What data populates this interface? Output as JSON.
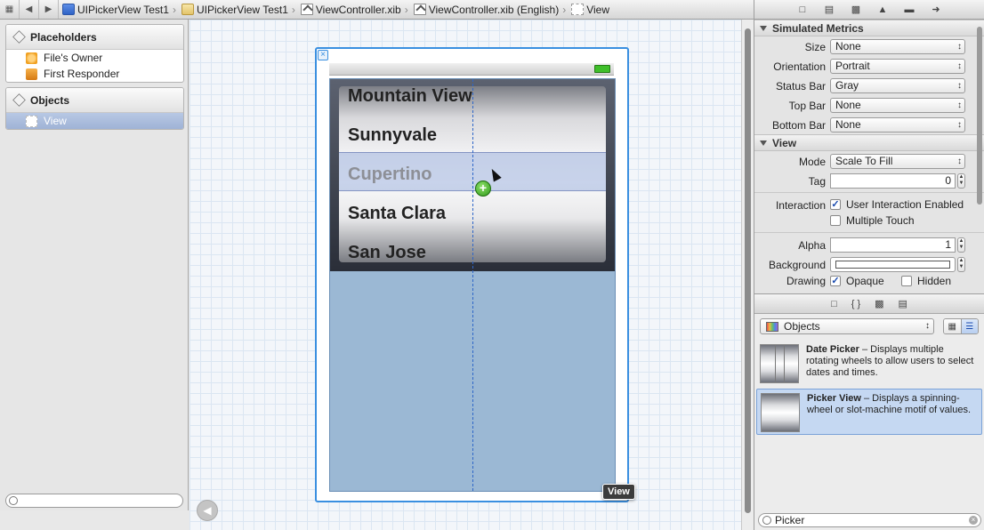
{
  "breadcrumbs": [
    {
      "label": "UIPickerView Test1",
      "icon": "project-icon"
    },
    {
      "label": "UIPickerView Test1",
      "icon": "folder-icon"
    },
    {
      "label": "ViewController.xib",
      "icon": "xib-icon"
    },
    {
      "label": "ViewController.xib (English)",
      "icon": "xib-icon"
    },
    {
      "label": "View",
      "icon": "view-icon"
    }
  ],
  "outline": {
    "placeholders_title": "Placeholders",
    "placeholders": [
      "File's Owner",
      "First Responder"
    ],
    "objects_title": "Objects",
    "objects": [
      "View"
    ]
  },
  "picker": {
    "items": [
      "Mountain View",
      "Sunnyvale",
      "Cupertino",
      "Santa Clara",
      "San Jose"
    ],
    "selected_index": 2
  },
  "canvas": {
    "selection_tooltip": "View"
  },
  "inspector": {
    "simulated_metrics_title": "Simulated Metrics",
    "size_label": "Size",
    "size_value": "None",
    "orientation_label": "Orientation",
    "orientation_value": "Portrait",
    "status_bar_label": "Status Bar",
    "status_bar_value": "Gray",
    "top_bar_label": "Top Bar",
    "top_bar_value": "None",
    "bottom_bar_label": "Bottom Bar",
    "bottom_bar_value": "None",
    "view_title": "View",
    "mode_label": "Mode",
    "mode_value": "Scale To Fill",
    "tag_label": "Tag",
    "tag_value": "0",
    "interaction_label": "Interaction",
    "user_interaction_label": "User Interaction Enabled",
    "user_interaction_checked": true,
    "multiple_touch_label": "Multiple Touch",
    "multiple_touch_checked": false,
    "alpha_label": "Alpha",
    "alpha_value": "1",
    "background_label": "Background",
    "drawing_label": "Drawing",
    "opaque_label": "Opaque",
    "hidden_label": "Hidden"
  },
  "library": {
    "category": "Objects",
    "items": [
      {
        "title": "Date Picker",
        "desc": " – Displays multiple rotating wheels to allow users to select dates and times."
      },
      {
        "title": "Picker View",
        "desc": " – Displays a spinning-wheel or slot-machine motif of values."
      }
    ],
    "search_value": "Picker"
  },
  "colors": {
    "selection_blue": "#3a8fe0",
    "picker_frame": "#2a2e38",
    "view_background": "#9bb8d4",
    "outline_selection": "#9fb3d6",
    "library_selection": "#c5d8f2"
  }
}
